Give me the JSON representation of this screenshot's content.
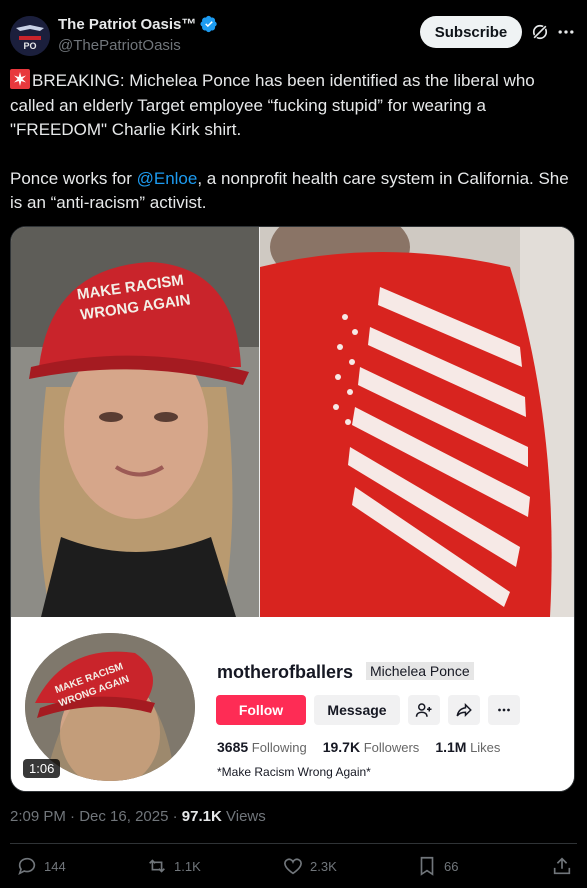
{
  "author": {
    "display_name": "The Patriot Oasis™",
    "handle": "@ThePatriotOasis",
    "verified": true
  },
  "header": {
    "subscribe_label": "Subscribe"
  },
  "tweet": {
    "line1": "BREAKING: Michelea Ponce has been identified as the liberal who called an elderly Target employee “fucking stupid” for wearing a \"FREEDOM\" Charlie Kirk shirt.",
    "line2_prefix": "Ponce works for ",
    "mention": "@Enloe",
    "line2_suffix": ", a nonprofit health care system in California. She is an “anti-racism” activist."
  },
  "media": {
    "hat_text_line1": "MAKE RACISM",
    "hat_text_line2": "WRONG AGAIN",
    "video_time": "1:06",
    "profile": {
      "username": "motherofballers",
      "real_name": "Michelea Ponce",
      "follow_label": "Follow",
      "message_label": "Message",
      "following_count": "3685",
      "following_label": "Following",
      "followers_count": "19.7K",
      "followers_label": "Followers",
      "likes_count": "1.1M",
      "likes_label": "Likes",
      "bio": "*Make Racism Wrong Again*"
    }
  },
  "meta": {
    "time": "2:09 PM",
    "date": "Dec 16, 2025",
    "views_count": "97.1K",
    "views_label": "Views"
  },
  "actions": {
    "replies": "144",
    "reposts": "1.1K",
    "likes": "2.3K",
    "bookmarks": "66"
  },
  "colors": {
    "link": "#1d9bf0",
    "verified": "#1d9bf0",
    "tiktok_red": "#fe2c55",
    "muted": "#71767b"
  }
}
